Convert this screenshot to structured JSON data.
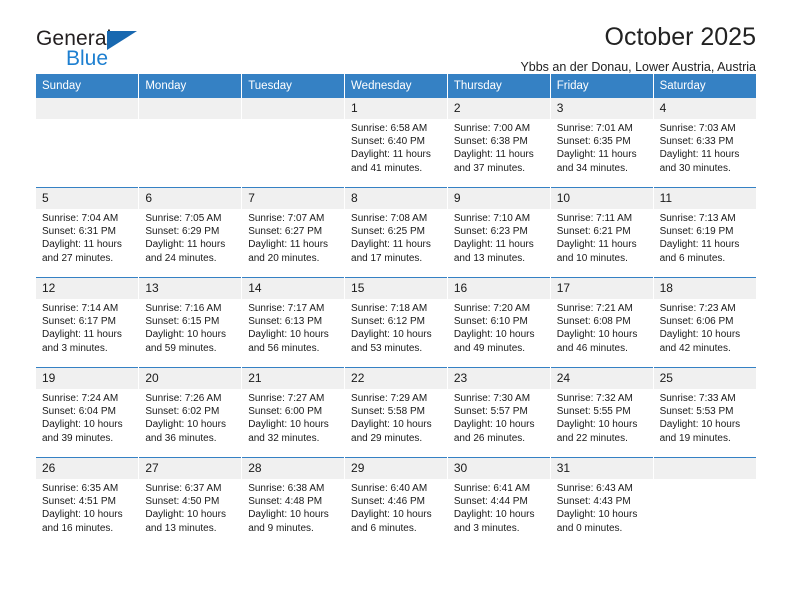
{
  "brand": {
    "name_part1": "General",
    "name_part2": "Blue",
    "triangle_color": "#1868b0",
    "blue_color": "#1d7fd0"
  },
  "header": {
    "title": "October 2025",
    "subtitle": "Ybbs an der Donau, Lower Austria, Austria"
  },
  "theme": {
    "header_bg": "#3581c4",
    "daynum_bg": "#f0f0f0",
    "row_border": "#3581c4"
  },
  "weekdays": [
    "Sunday",
    "Monday",
    "Tuesday",
    "Wednesday",
    "Thursday",
    "Friday",
    "Saturday"
  ],
  "weeks": [
    [
      {
        "day": "",
        "sunrise": "",
        "sunset": "",
        "daylight_line1": "",
        "daylight_line2": ""
      },
      {
        "day": "",
        "sunrise": "",
        "sunset": "",
        "daylight_line1": "",
        "daylight_line2": ""
      },
      {
        "day": "",
        "sunrise": "",
        "sunset": "",
        "daylight_line1": "",
        "daylight_line2": ""
      },
      {
        "day": "1",
        "sunrise": "Sunrise: 6:58 AM",
        "sunset": "Sunset: 6:40 PM",
        "daylight_line1": "Daylight: 11 hours",
        "daylight_line2": "and 41 minutes."
      },
      {
        "day": "2",
        "sunrise": "Sunrise: 7:00 AM",
        "sunset": "Sunset: 6:38 PM",
        "daylight_line1": "Daylight: 11 hours",
        "daylight_line2": "and 37 minutes."
      },
      {
        "day": "3",
        "sunrise": "Sunrise: 7:01 AM",
        "sunset": "Sunset: 6:35 PM",
        "daylight_line1": "Daylight: 11 hours",
        "daylight_line2": "and 34 minutes."
      },
      {
        "day": "4",
        "sunrise": "Sunrise: 7:03 AM",
        "sunset": "Sunset: 6:33 PM",
        "daylight_line1": "Daylight: 11 hours",
        "daylight_line2": "and 30 minutes."
      }
    ],
    [
      {
        "day": "5",
        "sunrise": "Sunrise: 7:04 AM",
        "sunset": "Sunset: 6:31 PM",
        "daylight_line1": "Daylight: 11 hours",
        "daylight_line2": "and 27 minutes."
      },
      {
        "day": "6",
        "sunrise": "Sunrise: 7:05 AM",
        "sunset": "Sunset: 6:29 PM",
        "daylight_line1": "Daylight: 11 hours",
        "daylight_line2": "and 24 minutes."
      },
      {
        "day": "7",
        "sunrise": "Sunrise: 7:07 AM",
        "sunset": "Sunset: 6:27 PM",
        "daylight_line1": "Daylight: 11 hours",
        "daylight_line2": "and 20 minutes."
      },
      {
        "day": "8",
        "sunrise": "Sunrise: 7:08 AM",
        "sunset": "Sunset: 6:25 PM",
        "daylight_line1": "Daylight: 11 hours",
        "daylight_line2": "and 17 minutes."
      },
      {
        "day": "9",
        "sunrise": "Sunrise: 7:10 AM",
        "sunset": "Sunset: 6:23 PM",
        "daylight_line1": "Daylight: 11 hours",
        "daylight_line2": "and 13 minutes."
      },
      {
        "day": "10",
        "sunrise": "Sunrise: 7:11 AM",
        "sunset": "Sunset: 6:21 PM",
        "daylight_line1": "Daylight: 11 hours",
        "daylight_line2": "and 10 minutes."
      },
      {
        "day": "11",
        "sunrise": "Sunrise: 7:13 AM",
        "sunset": "Sunset: 6:19 PM",
        "daylight_line1": "Daylight: 11 hours",
        "daylight_line2": "and 6 minutes."
      }
    ],
    [
      {
        "day": "12",
        "sunrise": "Sunrise: 7:14 AM",
        "sunset": "Sunset: 6:17 PM",
        "daylight_line1": "Daylight: 11 hours",
        "daylight_line2": "and 3 minutes."
      },
      {
        "day": "13",
        "sunrise": "Sunrise: 7:16 AM",
        "sunset": "Sunset: 6:15 PM",
        "daylight_line1": "Daylight: 10 hours",
        "daylight_line2": "and 59 minutes."
      },
      {
        "day": "14",
        "sunrise": "Sunrise: 7:17 AM",
        "sunset": "Sunset: 6:13 PM",
        "daylight_line1": "Daylight: 10 hours",
        "daylight_line2": "and 56 minutes."
      },
      {
        "day": "15",
        "sunrise": "Sunrise: 7:18 AM",
        "sunset": "Sunset: 6:12 PM",
        "daylight_line1": "Daylight: 10 hours",
        "daylight_line2": "and 53 minutes."
      },
      {
        "day": "16",
        "sunrise": "Sunrise: 7:20 AM",
        "sunset": "Sunset: 6:10 PM",
        "daylight_line1": "Daylight: 10 hours",
        "daylight_line2": "and 49 minutes."
      },
      {
        "day": "17",
        "sunrise": "Sunrise: 7:21 AM",
        "sunset": "Sunset: 6:08 PM",
        "daylight_line1": "Daylight: 10 hours",
        "daylight_line2": "and 46 minutes."
      },
      {
        "day": "18",
        "sunrise": "Sunrise: 7:23 AM",
        "sunset": "Sunset: 6:06 PM",
        "daylight_line1": "Daylight: 10 hours",
        "daylight_line2": "and 42 minutes."
      }
    ],
    [
      {
        "day": "19",
        "sunrise": "Sunrise: 7:24 AM",
        "sunset": "Sunset: 6:04 PM",
        "daylight_line1": "Daylight: 10 hours",
        "daylight_line2": "and 39 minutes."
      },
      {
        "day": "20",
        "sunrise": "Sunrise: 7:26 AM",
        "sunset": "Sunset: 6:02 PM",
        "daylight_line1": "Daylight: 10 hours",
        "daylight_line2": "and 36 minutes."
      },
      {
        "day": "21",
        "sunrise": "Sunrise: 7:27 AM",
        "sunset": "Sunset: 6:00 PM",
        "daylight_line1": "Daylight: 10 hours",
        "daylight_line2": "and 32 minutes."
      },
      {
        "day": "22",
        "sunrise": "Sunrise: 7:29 AM",
        "sunset": "Sunset: 5:58 PM",
        "daylight_line1": "Daylight: 10 hours",
        "daylight_line2": "and 29 minutes."
      },
      {
        "day": "23",
        "sunrise": "Sunrise: 7:30 AM",
        "sunset": "Sunset: 5:57 PM",
        "daylight_line1": "Daylight: 10 hours",
        "daylight_line2": "and 26 minutes."
      },
      {
        "day": "24",
        "sunrise": "Sunrise: 7:32 AM",
        "sunset": "Sunset: 5:55 PM",
        "daylight_line1": "Daylight: 10 hours",
        "daylight_line2": "and 22 minutes."
      },
      {
        "day": "25",
        "sunrise": "Sunrise: 7:33 AM",
        "sunset": "Sunset: 5:53 PM",
        "daylight_line1": "Daylight: 10 hours",
        "daylight_line2": "and 19 minutes."
      }
    ],
    [
      {
        "day": "26",
        "sunrise": "Sunrise: 6:35 AM",
        "sunset": "Sunset: 4:51 PM",
        "daylight_line1": "Daylight: 10 hours",
        "daylight_line2": "and 16 minutes."
      },
      {
        "day": "27",
        "sunrise": "Sunrise: 6:37 AM",
        "sunset": "Sunset: 4:50 PM",
        "daylight_line1": "Daylight: 10 hours",
        "daylight_line2": "and 13 minutes."
      },
      {
        "day": "28",
        "sunrise": "Sunrise: 6:38 AM",
        "sunset": "Sunset: 4:48 PM",
        "daylight_line1": "Daylight: 10 hours",
        "daylight_line2": "and 9 minutes."
      },
      {
        "day": "29",
        "sunrise": "Sunrise: 6:40 AM",
        "sunset": "Sunset: 4:46 PM",
        "daylight_line1": "Daylight: 10 hours",
        "daylight_line2": "and 6 minutes."
      },
      {
        "day": "30",
        "sunrise": "Sunrise: 6:41 AM",
        "sunset": "Sunset: 4:44 PM",
        "daylight_line1": "Daylight: 10 hours",
        "daylight_line2": "and 3 minutes."
      },
      {
        "day": "31",
        "sunrise": "Sunrise: 6:43 AM",
        "sunset": "Sunset: 4:43 PM",
        "daylight_line1": "Daylight: 10 hours",
        "daylight_line2": "and 0 minutes."
      },
      {
        "day": "",
        "sunrise": "",
        "sunset": "",
        "daylight_line1": "",
        "daylight_line2": ""
      }
    ]
  ]
}
